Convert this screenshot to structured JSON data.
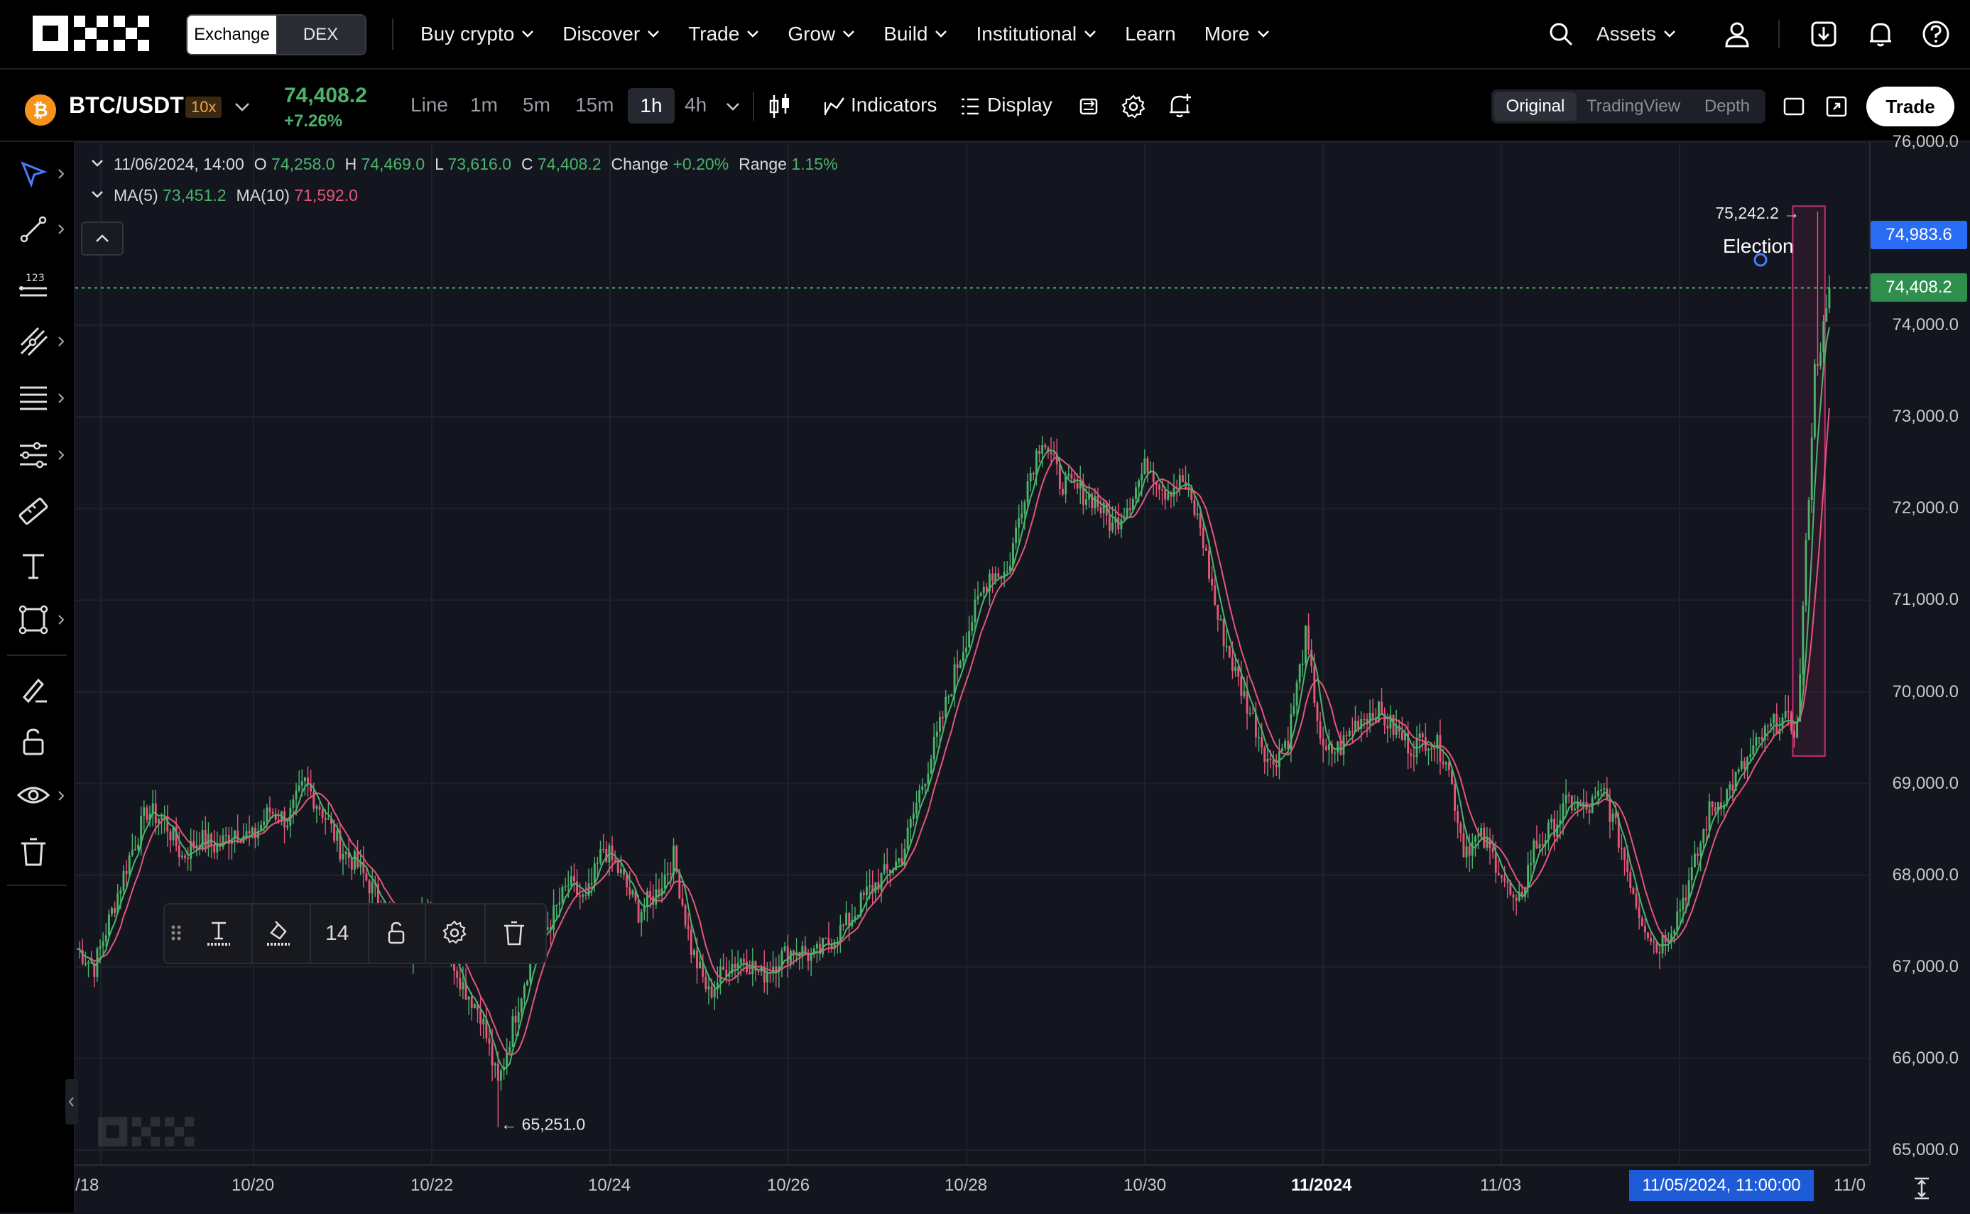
{
  "nav": {
    "logo": "OKX",
    "exchange_tab": "Exchange",
    "dex_tab": "DEX",
    "menu": [
      "Buy crypto",
      "Discover",
      "Trade",
      "Grow",
      "Build",
      "Institutional",
      "Learn",
      "More"
    ],
    "menu_has_dropdown": [
      true,
      true,
      true,
      true,
      true,
      true,
      false,
      true
    ],
    "assets": "Assets"
  },
  "toolbar": {
    "pair": "BTC/USDT",
    "leverage": "10x",
    "last_price": "74,408.2",
    "change_pct": "+7.26%",
    "timeframes": [
      "Line",
      "1m",
      "5m",
      "15m",
      "1h",
      "4h"
    ],
    "selected_timeframe": "1h",
    "indicators": "Indicators",
    "display": "Display",
    "views": [
      "Original",
      "TradingView",
      "Depth"
    ],
    "selected_view": "Original",
    "trade_button": "Trade"
  },
  "legend": {
    "date": "11/06/2024, 14:00",
    "o_label": "O",
    "o": "74,258.0",
    "h_label": "H",
    "h": "74,469.0",
    "l_label": "L",
    "l": "73,616.0",
    "c_label": "C",
    "c": "74,408.2",
    "change_label": "Change",
    "change": "+0.20%",
    "range_label": "Range",
    "range": "1.15%",
    "ma5_label": "MA(5)",
    "ma5": "73,451.2",
    "ma10_label": "MA(10)",
    "ma10": "71,592.0"
  },
  "drawing_toolbar": {
    "font_size": "14"
  },
  "annotations": {
    "high_label": "75,242.2 →",
    "low_label": "← 65,251.0",
    "text_label": "Election",
    "crosshair_price": "74,983.6",
    "last_price_tag": "74,408.2",
    "crosshair_time": "11/05/2024, 11:00:00"
  },
  "colors": {
    "up": "#4bb36a",
    "down": "#e4567a",
    "ma5": "#4bb36a",
    "ma10": "#e4567a",
    "crosshair_tag": "#2a6df5",
    "highlight_box": "#c0306e"
  },
  "chart_data": {
    "type": "candlestick",
    "interval": "1h",
    "y_axis": {
      "ticks": [
        65000,
        66000,
        67000,
        68000,
        69000,
        70000,
        71000,
        72000,
        73000,
        74000,
        76000
      ],
      "tick_labels": [
        "65,000.0",
        "66,000.0",
        "67,000.0",
        "68,000.0",
        "69,000.0",
        "70,000.0",
        "71,000.0",
        "72,000.0",
        "73,000.0",
        "74,000.0",
        "76,000.0"
      ],
      "range": [
        65000,
        76000
      ]
    },
    "x_axis": {
      "tick_labels": [
        "/18",
        "10/20",
        "10/22",
        "10/24",
        "10/26",
        "10/28",
        "10/30",
        "11/2024",
        "11/03",
        "11/0"
      ]
    },
    "series": [
      {
        "name": "MA(5)"
      },
      {
        "name": "MA(10)"
      }
    ],
    "path_points": [
      [
        0,
        67200
      ],
      [
        6,
        67000
      ],
      [
        12,
        67600
      ],
      [
        18,
        68200
      ],
      [
        24,
        68700
      ],
      [
        30,
        68600
      ],
      [
        36,
        68200
      ],
      [
        42,
        68400
      ],
      [
        48,
        68300
      ],
      [
        54,
        68500
      ],
      [
        60,
        68400
      ],
      [
        66,
        68700
      ],
      [
        72,
        68600
      ],
      [
        78,
        69000
      ],
      [
        84,
        68700
      ],
      [
        90,
        68300
      ],
      [
        96,
        68100
      ],
      [
        102,
        67800
      ],
      [
        108,
        67500
      ],
      [
        114,
        67200
      ],
      [
        120,
        67700
      ],
      [
        126,
        67300
      ],
      [
        132,
        66800
      ],
      [
        138,
        66500
      ],
      [
        144,
        65700
      ],
      [
        150,
        66500
      ],
      [
        156,
        67200
      ],
      [
        162,
        67500
      ],
      [
        168,
        67900
      ],
      [
        174,
        67700
      ],
      [
        180,
        68300
      ],
      [
        186,
        68000
      ],
      [
        192,
        67600
      ],
      [
        198,
        67800
      ],
      [
        204,
        68200
      ],
      [
        210,
        67200
      ],
      [
        216,
        66700
      ],
      [
        222,
        67000
      ],
      [
        228,
        67100
      ],
      [
        234,
        66900
      ],
      [
        240,
        67100
      ],
      [
        246,
        67200
      ],
      [
        252,
        67100
      ],
      [
        258,
        67300
      ],
      [
        264,
        67500
      ],
      [
        270,
        67800
      ],
      [
        276,
        68000
      ],
      [
        282,
        68200
      ],
      [
        288,
        68900
      ],
      [
        294,
        69500
      ],
      [
        300,
        70200
      ],
      [
        306,
        70800
      ],
      [
        312,
        71300
      ],
      [
        318,
        71300
      ],
      [
        324,
        72200
      ],
      [
        330,
        72800
      ],
      [
        336,
        72300
      ],
      [
        342,
        72200
      ],
      [
        348,
        72100
      ],
      [
        354,
        71800
      ],
      [
        360,
        72100
      ],
      [
        366,
        72500
      ],
      [
        372,
        72200
      ],
      [
        378,
        72300
      ],
      [
        384,
        71800
      ],
      [
        390,
        70800
      ],
      [
        396,
        70200
      ],
      [
        402,
        69700
      ],
      [
        408,
        69200
      ],
      [
        414,
        69500
      ],
      [
        420,
        70600
      ],
      [
        426,
        69300
      ],
      [
        432,
        69400
      ],
      [
        438,
        69700
      ],
      [
        444,
        69800
      ],
      [
        450,
        69600
      ],
      [
        456,
        69400
      ],
      [
        462,
        69500
      ],
      [
        468,
        69300
      ],
      [
        474,
        68300
      ],
      [
        480,
        68400
      ],
      [
        486,
        68100
      ],
      [
        492,
        67600
      ],
      [
        498,
        68300
      ],
      [
        504,
        68500
      ],
      [
        510,
        68800
      ],
      [
        516,
        68700
      ],
      [
        522,
        68900
      ],
      [
        528,
        68300
      ],
      [
        534,
        67600
      ],
      [
        540,
        67200
      ],
      [
        546,
        67500
      ],
      [
        552,
        68000
      ],
      [
        558,
        68700
      ],
      [
        564,
        68900
      ],
      [
        570,
        69200
      ],
      [
        576,
        69500
      ],
      [
        582,
        69700
      ],
      [
        588,
        69600
      ],
      [
        594,
        73500
      ],
      [
        600,
        74408
      ]
    ],
    "candles_hourly_total": 600,
    "highlight_box_price_range": [
      69300,
      75300
    ],
    "dotted_reference_price": 74408.2,
    "low": 65251.0,
    "high": 75242.2
  }
}
